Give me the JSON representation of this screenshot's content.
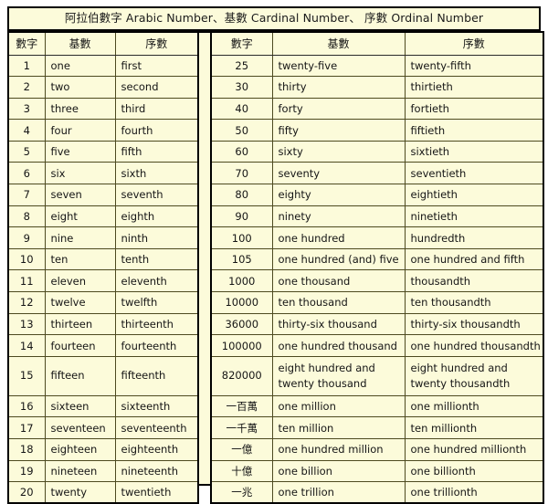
{
  "title": "阿拉伯數字 Arabic Number、基數 Cardinal Number、 序數 Ordinal Number",
  "colors": {
    "cell_background": "#fcfbda",
    "page_background": "#ffffff",
    "border": "#4d4a20",
    "outer_border": "#000000",
    "text": "#151515"
  },
  "headers": {
    "number": "數字",
    "cardinal": "基數",
    "ordinal": "序數"
  },
  "left_table": {
    "rows": [
      {
        "number": "1",
        "cardinal": "one",
        "ordinal": "first",
        "tall": false
      },
      {
        "number": "2",
        "cardinal": "two",
        "ordinal": "second",
        "tall": false
      },
      {
        "number": "3",
        "cardinal": "three",
        "ordinal": "third",
        "tall": false
      },
      {
        "number": "4",
        "cardinal": "four",
        "ordinal": "fourth",
        "tall": false
      },
      {
        "number": "5",
        "cardinal": "five",
        "ordinal": "fifth",
        "tall": false
      },
      {
        "number": "6",
        "cardinal": "six",
        "ordinal": "sixth",
        "tall": false
      },
      {
        "number": "7",
        "cardinal": "seven",
        "ordinal": "seventh",
        "tall": false
      },
      {
        "number": "8",
        "cardinal": "eight",
        "ordinal": "eighth",
        "tall": false
      },
      {
        "number": "9",
        "cardinal": "nine",
        "ordinal": "ninth",
        "tall": false
      },
      {
        "number": "10",
        "cardinal": "ten",
        "ordinal": "tenth",
        "tall": false
      },
      {
        "number": "11",
        "cardinal": "eleven",
        "ordinal": "eleventh",
        "tall": false
      },
      {
        "number": "12",
        "cardinal": "twelve",
        "ordinal": "twelfth",
        "tall": false
      },
      {
        "number": "13",
        "cardinal": "thirteen",
        "ordinal": "thirteenth",
        "tall": false
      },
      {
        "number": "14",
        "cardinal": "fourteen",
        "ordinal": "fourteenth",
        "tall": false
      },
      {
        "number": "15",
        "cardinal": "fifteen",
        "ordinal": "fifteenth",
        "tall": true
      },
      {
        "number": "16",
        "cardinal": "sixteen",
        "ordinal": "sixteenth",
        "tall": false
      },
      {
        "number": "17",
        "cardinal": "seventeen",
        "ordinal": "seventeenth",
        "tall": false
      },
      {
        "number": "18",
        "cardinal": "eighteen",
        "ordinal": "eighteenth",
        "tall": false
      },
      {
        "number": "19",
        "cardinal": "nineteen",
        "ordinal": "nineteenth",
        "tall": false
      },
      {
        "number": "20",
        "cardinal": "twenty",
        "ordinal": "twentieth",
        "tall": false
      }
    ]
  },
  "right_table": {
    "rows": [
      {
        "number": "25",
        "cardinal": "twenty-five",
        "ordinal": "twenty-fifth",
        "tall": false
      },
      {
        "number": "30",
        "cardinal": "thirty",
        "ordinal": "thirtieth",
        "tall": false
      },
      {
        "number": "40",
        "cardinal": "forty",
        "ordinal": "fortieth",
        "tall": false
      },
      {
        "number": "50",
        "cardinal": "fifty",
        "ordinal": "fiftieth",
        "tall": false
      },
      {
        "number": "60",
        "cardinal": "sixty",
        "ordinal": "sixtieth",
        "tall": false
      },
      {
        "number": "70",
        "cardinal": "seventy",
        "ordinal": "seventieth",
        "tall": false
      },
      {
        "number": "80",
        "cardinal": "eighty",
        "ordinal": "eightieth",
        "tall": false
      },
      {
        "number": "90",
        "cardinal": "ninety",
        "ordinal": "ninetieth",
        "tall": false
      },
      {
        "number": "100",
        "cardinal": "one hundred",
        "ordinal": "hundredth",
        "tall": false
      },
      {
        "number": "105",
        "cardinal": "one hundred  (and) five",
        "ordinal": "one hundred  and fifth",
        "tall": false
      },
      {
        "number": "1000",
        "cardinal": "one thousand",
        "ordinal": "thousandth",
        "tall": false
      },
      {
        "number": "10000",
        "cardinal": "ten thousand",
        "ordinal": "ten thousandth",
        "tall": false
      },
      {
        "number": "36000",
        "cardinal": "thirty-six thousand",
        "ordinal": "thirty-six thousandth",
        "tall": false
      },
      {
        "number": "100000",
        "cardinal": "one hundred  thousand",
        "ordinal": "one hundred  thousandth",
        "tall": false
      },
      {
        "number": "820000",
        "cardinal": "eight hundred  and twenty thousand",
        "ordinal": "eight hundred  and twenty thousandth",
        "tall": true
      },
      {
        "number": "一百萬",
        "cardinal": "one million",
        "ordinal": "one millionth",
        "tall": false
      },
      {
        "number": "一千萬",
        "cardinal": "ten million",
        "ordinal": "ten millionth",
        "tall": false
      },
      {
        "number": "一億",
        "cardinal": "one hundred  million",
        "ordinal": "one hundred  millionth",
        "tall": false
      },
      {
        "number": "十億",
        "cardinal": "one billion",
        "ordinal": "one billionth",
        "tall": false
      },
      {
        "number": "一兆",
        "cardinal": "one trillion",
        "ordinal": "one trillionth",
        "tall": false
      }
    ]
  }
}
